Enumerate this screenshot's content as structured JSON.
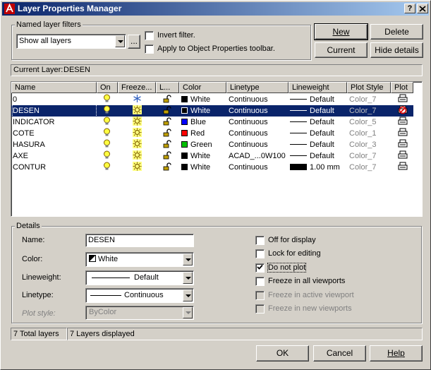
{
  "window": {
    "title": "Layer Properties Manager",
    "help_btn": "?",
    "close_btn": "X"
  },
  "filters": {
    "group_label": "Named layer filters",
    "selected": "Show all layers",
    "more_btn": "...",
    "invert_label": "Invert filter.",
    "invert_checked": false,
    "apply_label": "Apply to Object Properties toolbar.",
    "apply_checked": false
  },
  "buttons": {
    "new": "New",
    "delete": "Delete",
    "current": "Current",
    "hide_details": "Hide details",
    "ok": "OK",
    "cancel": "Cancel",
    "help": "Help"
  },
  "current_layer": {
    "label": "Current Layer:",
    "value": "DESEN"
  },
  "columns": [
    "Name",
    "On",
    "Freeze...",
    "L...",
    "Color",
    "Linetype",
    "Lineweight",
    "Plot Style",
    "Plot"
  ],
  "layers": [
    {
      "name": "0",
      "color_name": "White",
      "color": "#000000",
      "linetype": "Continuous",
      "lineweight": "Default",
      "plot_style": "Color_7",
      "selected": false,
      "thick": false,
      "frozen_icon": "snowflake",
      "noplot": false
    },
    {
      "name": "DESEN",
      "color_name": "White",
      "color": "#000000",
      "linetype": "Continuous",
      "lineweight": "Default",
      "plot_style": "Color_7",
      "selected": true,
      "thick": false,
      "frozen_icon": "sun",
      "noplot": true
    },
    {
      "name": "INDICATOR",
      "color_name": "Blue",
      "color": "#0000ff",
      "linetype": "Continuous",
      "lineweight": "Default",
      "plot_style": "Color_5",
      "selected": false,
      "thick": false,
      "frozen_icon": "sun",
      "noplot": false
    },
    {
      "name": "COTE",
      "color_name": "Red",
      "color": "#ff0000",
      "linetype": "Continuous",
      "lineweight": "Default",
      "plot_style": "Color_1",
      "selected": false,
      "thick": false,
      "frozen_icon": "sun",
      "noplot": false
    },
    {
      "name": "HASURA",
      "color_name": "Green",
      "color": "#00c000",
      "linetype": "Continuous",
      "lineweight": "Default",
      "plot_style": "Color_3",
      "selected": false,
      "thick": false,
      "frozen_icon": "sun",
      "noplot": false
    },
    {
      "name": "AXE",
      "color_name": "White",
      "color": "#000000",
      "linetype": "ACAD_...0W100",
      "lineweight": "Default",
      "plot_style": "Color_7",
      "selected": false,
      "thick": false,
      "frozen_icon": "sun",
      "noplot": false
    },
    {
      "name": "CONTUR",
      "color_name": "White",
      "color": "#000000",
      "linetype": "Continuous",
      "lineweight": "1.00 mm",
      "plot_style": "Color_7",
      "selected": false,
      "thick": true,
      "frozen_icon": "sun",
      "noplot": false
    }
  ],
  "details": {
    "group_label": "Details",
    "name_label": "Name:",
    "name_value": "DESEN",
    "color_label": "Color:",
    "color_value": "White",
    "lineweight_label": "Lineweight:",
    "lineweight_value": "Default",
    "linetype_label": "Linetype:",
    "linetype_value": "Continuous",
    "plotstyle_label": "Plot style:",
    "plotstyle_value": "ByColor",
    "off_label": "Off for display",
    "off_checked": false,
    "lock_label": "Lock for editing",
    "lock_checked": false,
    "noplot_label": "Do not plot",
    "noplot_checked": true,
    "freeze_all_label": "Freeze in all viewports",
    "freeze_all_checked": false,
    "freeze_active_label": "Freeze in active viewport",
    "freeze_new_label": "Freeze in new viewports"
  },
  "status": {
    "total": "7 Total layers",
    "displayed": "7 Layers displayed"
  }
}
